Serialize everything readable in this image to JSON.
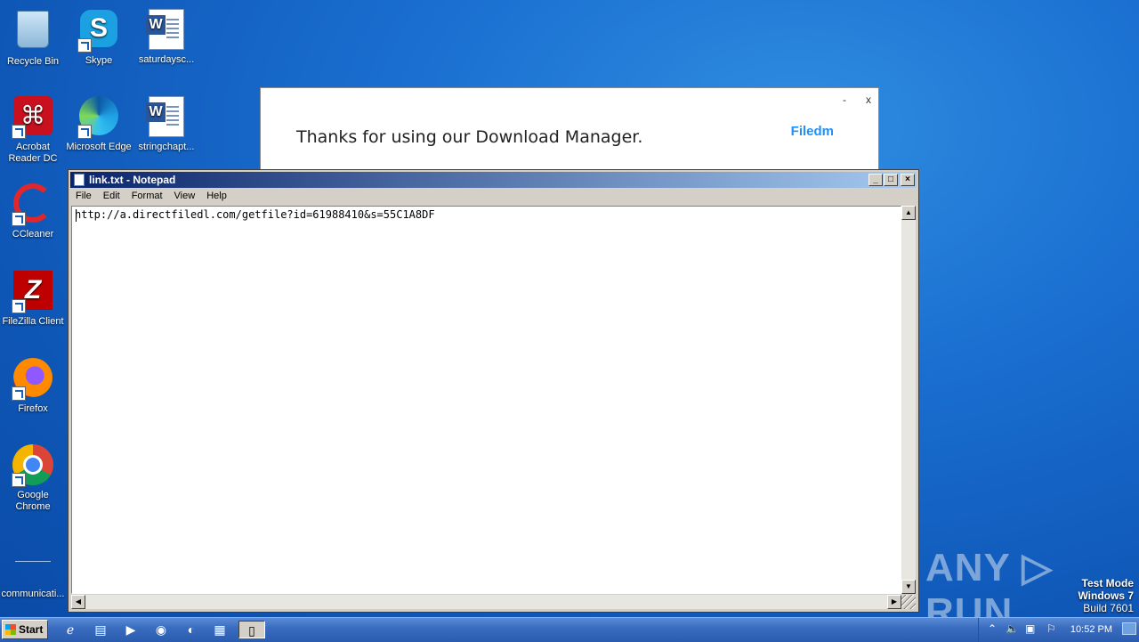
{
  "desktop": {
    "icons": [
      {
        "label": "Recycle Bin",
        "icon": "recycle-bin-icon"
      },
      {
        "label": "Skype",
        "icon": "skype-icon"
      },
      {
        "label": "saturdaysc...",
        "icon": "word-document-icon"
      },
      {
        "label": "Acrobat Reader DC",
        "icon": "acrobat-icon"
      },
      {
        "label": "Microsoft Edge",
        "icon": "edge-icon"
      },
      {
        "label": "stringchapt...",
        "icon": "word-document-icon"
      },
      {
        "label": "CCleaner",
        "icon": "ccleaner-icon"
      },
      {
        "label": "FileZilla Client",
        "icon": "filezilla-icon"
      },
      {
        "label": "Firefox",
        "icon": "firefox-icon"
      },
      {
        "label": "Google Chrome",
        "icon": "chrome-icon"
      },
      {
        "label": "communicati...",
        "icon": "document-icon"
      }
    ]
  },
  "download_manager": {
    "message": "Thanks for using our Download Manager.",
    "brand": "Filedm",
    "minimize": "-",
    "close": "x",
    "brand_color": "#1e90ff"
  },
  "notepad": {
    "title": "link.txt - Notepad",
    "menu": [
      "File",
      "Edit",
      "Format",
      "View",
      "Help"
    ],
    "content": "http://a.directfiledl.com/getfile?id=61988410&s=55C1A8DF",
    "min_glyph": "_",
    "max_glyph": "□",
    "close_glyph": "×"
  },
  "watermark": {
    "brand": "ANY ▷ RUN"
  },
  "test_mode": {
    "line1": "Test Mode",
    "line2": "Windows 7",
    "line3": "Build 7601"
  },
  "taskbar": {
    "start_label": "Start",
    "clock": "10:52 PM",
    "pinned": [
      "ie-icon",
      "explorer-icon",
      "media-player-icon",
      "chrome-icon",
      "edge-icon",
      "network-app-icon",
      "notepad-icon"
    ]
  }
}
